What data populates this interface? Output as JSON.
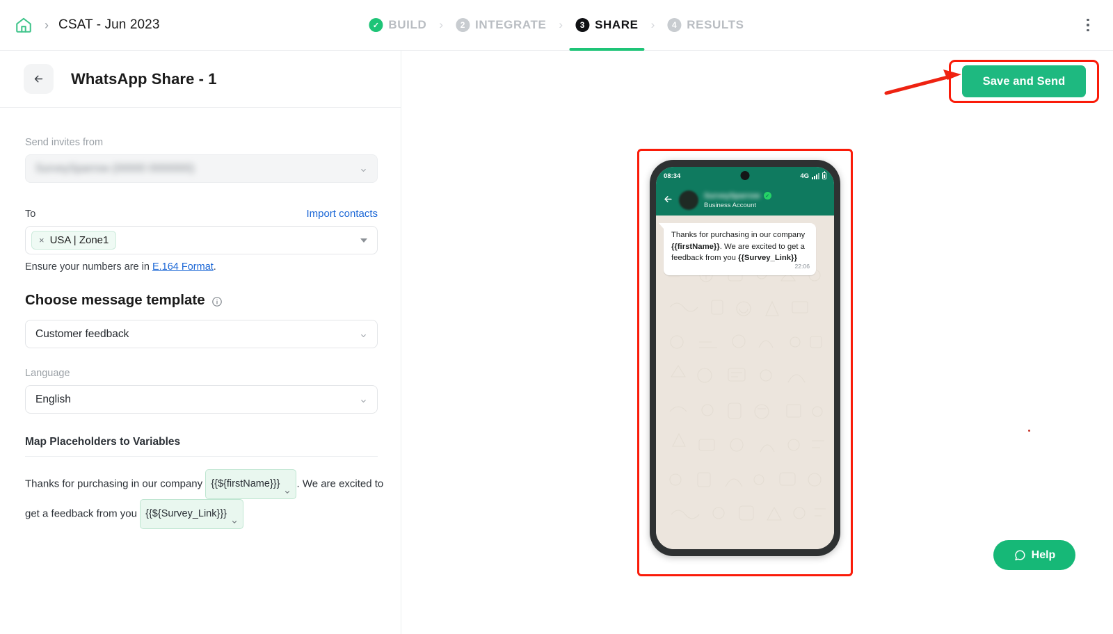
{
  "topbar": {
    "home_icon": "home-icon",
    "breadcrumb_separator": "›",
    "survey_title": "CSAT - Jun 2023",
    "menu_icon": "kebab-menu-icon",
    "steps": [
      {
        "id": "build",
        "badge": "✓",
        "label": "BUILD",
        "state": "done"
      },
      {
        "id": "integrate",
        "badge": "2",
        "label": "INTEGRATE",
        "state": "idle"
      },
      {
        "id": "share",
        "badge": "3",
        "label": "SHARE",
        "state": "active"
      },
      {
        "id": "results",
        "badge": "4",
        "label": "RESULTS",
        "state": "idle"
      }
    ],
    "step_separator": "›"
  },
  "panel": {
    "back_icon": "arrow-left-icon",
    "title": "WhatsApp Share - 1",
    "send_from": {
      "label": "Send invites from",
      "value": "SurveySparrow (00000 0000000)",
      "redacted": true,
      "caret_icon": "chevron-down-icon"
    },
    "to": {
      "label": "To",
      "import_link": "Import contacts",
      "chips": [
        {
          "remove_icon": "close-icon",
          "remove_label": "×",
          "label": "USA | Zone1"
        }
      ],
      "caret_icon": "caret-down-icon",
      "hint_prefix": "Ensure your numbers are in ",
      "hint_link": "E.164 Format",
      "hint_suffix": "."
    },
    "template": {
      "title": "Choose message template",
      "info_icon": "info-icon",
      "value": "Customer feedback",
      "caret_icon": "chevron-down-icon"
    },
    "language": {
      "label": "Language",
      "value": "English",
      "caret_icon": "chevron-down-icon"
    },
    "map": {
      "title": "Map Placeholders to Variables",
      "text_1": "Thanks for purchasing in our company",
      "chip_1": "{{${firstName}}}",
      "chip_1_caret": "chevron-down-icon",
      "text_2": ". We are excited to get a feedback from you",
      "chip_2": "{{${Survey_Link}}}",
      "chip_2_caret": "chevron-down-icon"
    }
  },
  "preview": {
    "phone": {
      "status_time": "08:34",
      "network": "4G",
      "signal_icon": "signal-bars-icon",
      "battery_icon": "battery-icon",
      "camera_icon": "front-camera-punch-hole"
    },
    "chat": {
      "back_icon": "arrow-left-icon",
      "avatar_icon": "contact-avatar",
      "contact_name": "SurveySparrow",
      "contact_name_redacted": true,
      "verified_icon": "verified-badge-icon",
      "verified_glyph": "✓",
      "subtitle": "Business Account",
      "message_part_1": "Thanks for purchasing in our company ",
      "message_var_1": "{{firstName}}",
      "message_part_2": ". We are excited to get a feedback from you ",
      "message_var_2": "{{Survey_Link}}",
      "message_time": "22:06"
    }
  },
  "actions": {
    "save_and_send": "Save and Send",
    "help_label": "Help",
    "help_icon": "chat-bubble-icon",
    "annotation_arrow": "red-arrow-pointing-right"
  },
  "colors": {
    "brand_green": "#1eb980",
    "whatsapp_green": "#0f7a5f",
    "annotation_red": "#fa1b09",
    "link_blue": "#1a66d6",
    "active_step": "#101114"
  }
}
